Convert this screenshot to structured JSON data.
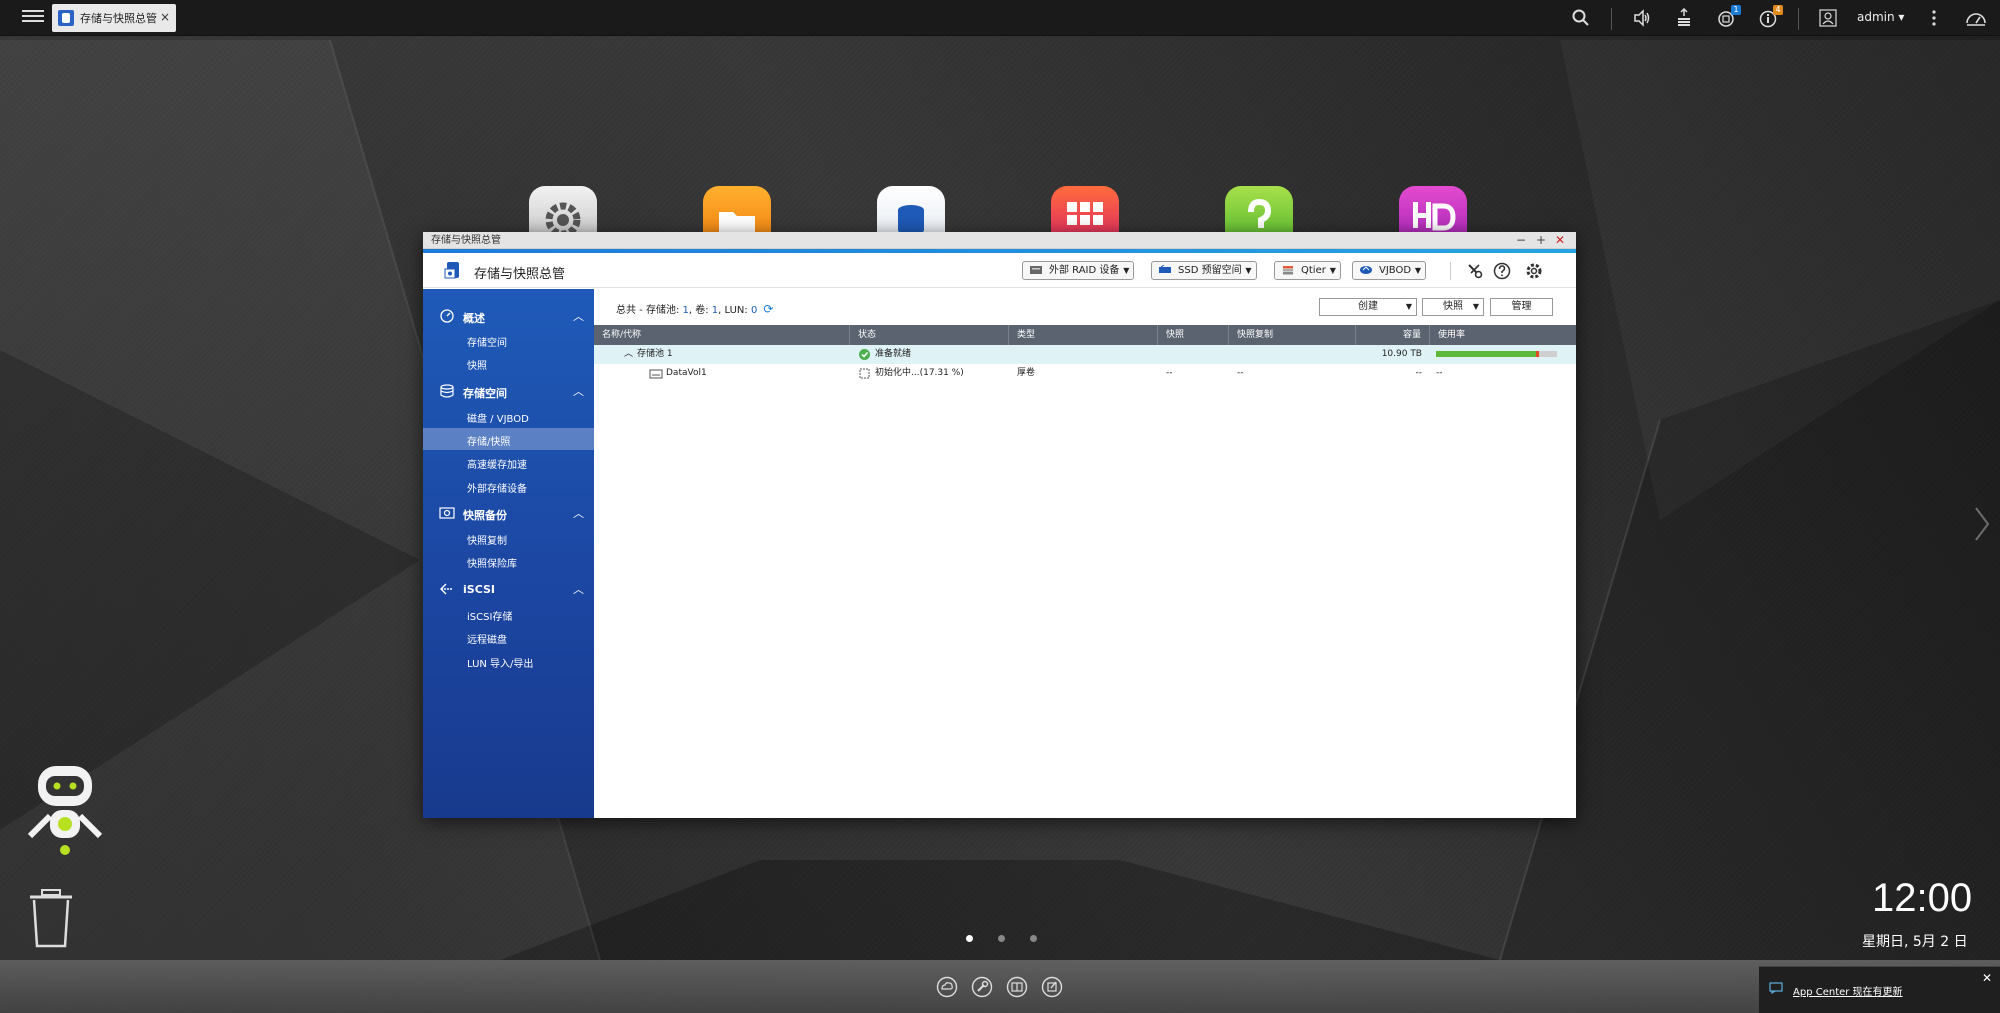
{
  "topbar": {
    "task_tab_label": "存储与快照总管",
    "task_tab_close": "×",
    "user": "admin ▾",
    "notification_count": "1",
    "info_count": "4"
  },
  "window": {
    "title": "存储与快照总管",
    "app_title": "存储与快照总管",
    "controls": {
      "minimize": "−",
      "maximize": "+",
      "close": "✕"
    },
    "header_buttons": {
      "external_raid": "外部 RAID 设备",
      "ssd_overprov": "SSD 预留空间",
      "qtier": "Qtier",
      "vjbod": "VJBOD"
    }
  },
  "sidebar": {
    "sections": [
      {
        "label": "概述",
        "items": [
          "存储空间",
          "快照"
        ]
      },
      {
        "label": "存储空间",
        "items": [
          "磁盘 / VJBOD",
          "存储/快照",
          "高速缓存加速",
          "外部存储设备"
        ]
      },
      {
        "label": "快照备份",
        "items": [
          "快照复制",
          "快照保险库"
        ]
      },
      {
        "label": "iSCSI",
        "items": [
          "iSCSI存储",
          "远程磁盘",
          "LUN 导入/导出"
        ]
      }
    ],
    "active_item": "存储/快照"
  },
  "content": {
    "summary": {
      "prefix": "总共 - 存储池: ",
      "pools": "1",
      "vol_prefix": ", 卷: ",
      "volumes": "1",
      "lun_prefix": ", LUN: ",
      "luns": "0"
    },
    "buttons": {
      "create": "创建",
      "snapshot": "快照",
      "manage": "管理"
    },
    "columns": [
      "名称/代称",
      "状态",
      "类型",
      "快照",
      "快照复制",
      "容量",
      "使用率"
    ],
    "rows": [
      {
        "name": "存储池 1",
        "status": "准备就绪",
        "type": "",
        "snapshot": "",
        "replication": "",
        "capacity": "10.90 TB",
        "usage": 0.85
      },
      {
        "name": "DataVol1",
        "status": "初始化中...(17.31 %)",
        "type": "厚卷",
        "snapshot": "--",
        "replication": "--",
        "capacity": "--",
        "usage_text": "--"
      }
    ]
  },
  "desktop": {
    "clock": "12:00",
    "date": "星期日, 5月 2 日",
    "notification": "App Center 现在有更新",
    "notification_close": "✕"
  },
  "colors": {
    "sidebar": "#1b45a0",
    "accent": "#1f7ad8",
    "table_header": "#5b6370",
    "pool_row": "#dff3f6",
    "usage_fill": "#5cb939",
    "status_ok": "#4caf50"
  }
}
